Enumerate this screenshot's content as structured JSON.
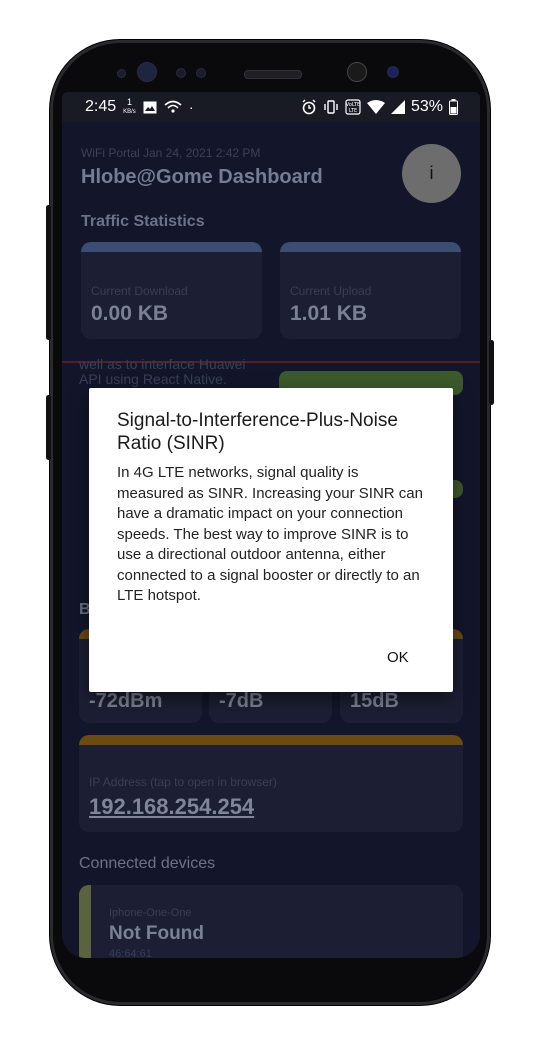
{
  "status_bar": {
    "time": "2:45",
    "net_speed_value": "1",
    "net_speed_unit": "KB/s",
    "battery": "53%"
  },
  "header": {
    "portal_line": "WiFi Portal Jan 24, 2021 2:42 PM",
    "title": "Hlobe@Gome Dashboard",
    "info_button": "i"
  },
  "traffic": {
    "title": "Traffic Statistics",
    "download_label": "Current Download",
    "download_value": "0.00 KB",
    "upload_label": "Current Upload",
    "upload_value": "1.01 KB"
  },
  "background_text": "well as to interface Huawei API using React Native.",
  "signal": {
    "section_letter": "B",
    "rsrp": "-72dBm",
    "rsrq": "-7dB",
    "sinr": "15dB"
  },
  "ip": {
    "label": "IP Address (tap to open in browser)",
    "value": "192.168.254.254"
  },
  "devices": {
    "title": "Connected devices",
    "device_name": "Iphone-One-One",
    "device_status": "Not Found",
    "device_mac": "46:64:61"
  },
  "dialog": {
    "title": "Signal-to-Interference-Plus-Noise Ratio (SINR)",
    "body": "In 4G LTE networks, signal quality is measured as SINR. Increasing your SINR can have a dramatic impact on your connection speeds. The best way to improve SINR is to use a directional outdoor antenna, either connected to a signal booster or directly to an LTE hotspot.",
    "ok_label": "OK"
  },
  "colors": {
    "app_background": "#13162b",
    "card": "#1c1f33",
    "download_cap": "#3b4d72",
    "orange_cap": "#6b4a14",
    "device_bar": "#59633d"
  }
}
